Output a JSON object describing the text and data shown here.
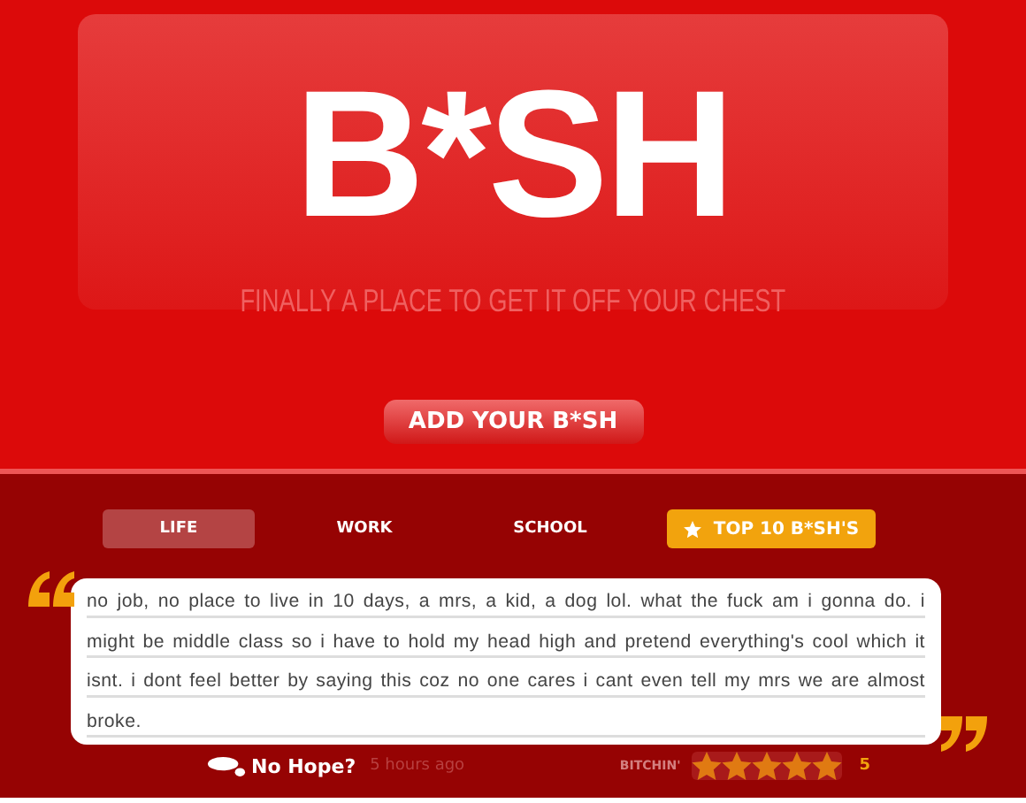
{
  "header": {
    "logo": "B*SH",
    "tagline": "FINALLY A PLACE TO GET IT OFF YOUR CHEST",
    "add_button": "ADD YOUR B*SH"
  },
  "tabs": [
    {
      "label": "LIFE",
      "selected": true,
      "kind": "plain"
    },
    {
      "label": "WORK",
      "selected": false,
      "kind": "plain"
    },
    {
      "label": "SCHOOL",
      "selected": false,
      "kind": "plain"
    },
    {
      "label": "TOP 10 B*SH'S",
      "selected": false,
      "kind": "featured"
    }
  ],
  "post": {
    "text": "no job, no place to live in 10 days, a mrs, a kid, a dog lol. what the fuck am i gonna do. i might be middle class so i have to hold my head high and pretend everything's cool which it isnt. i dont feel better by saying this coz no one cares i cant even tell my mrs we are almost broke.",
    "author": "No Hope?",
    "time": "5 hours ago",
    "rating_label": "BITCHIN'",
    "stars": 5,
    "score": "5"
  }
}
